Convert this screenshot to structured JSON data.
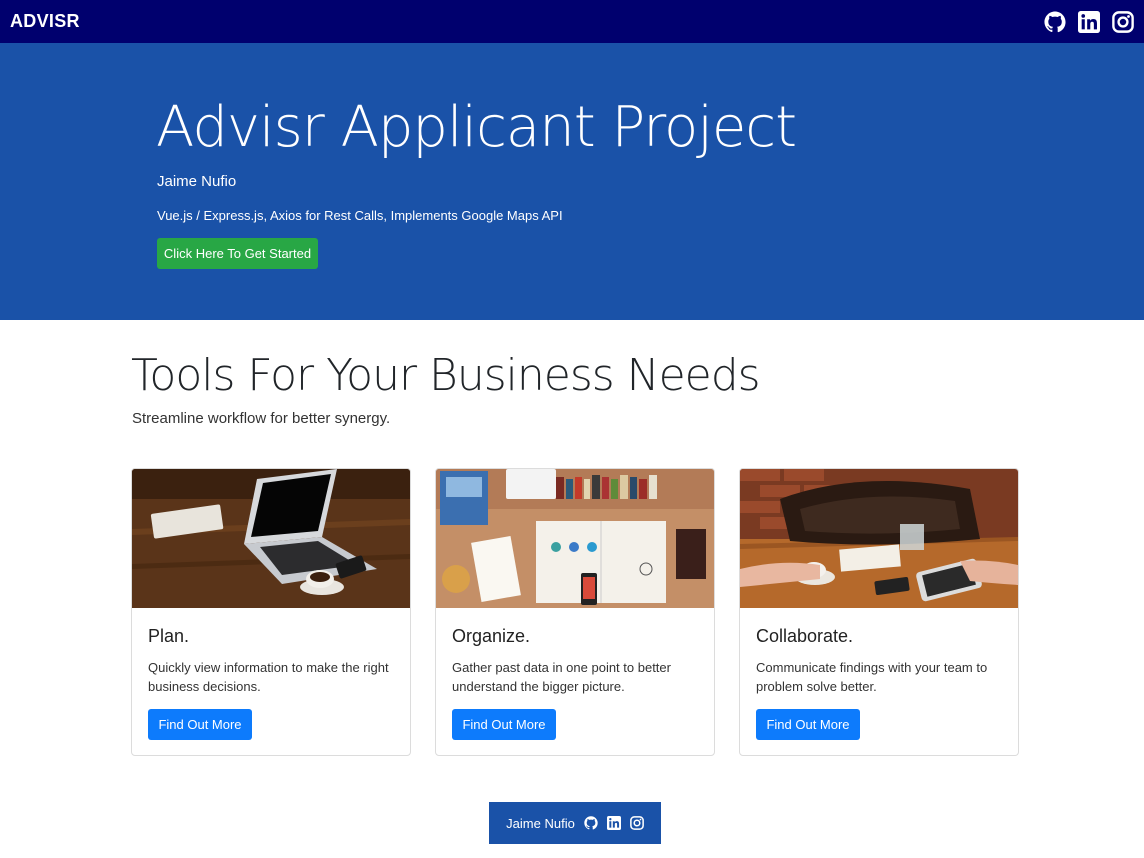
{
  "navbar": {
    "brand": "ADVISR",
    "icons": [
      "github-icon",
      "linkedin-icon",
      "instagram-icon"
    ]
  },
  "hero": {
    "title": "Advisr Applicant Project",
    "author": "Jaime Nufio",
    "tech": "Vue.js / Express.js, Axios for Rest Calls, Implements Google Maps API",
    "button_label": "Click Here To Get Started"
  },
  "section": {
    "title": "Tools For Your Business Needs",
    "subtitle": "Streamline workflow for better synergy."
  },
  "cards": [
    {
      "title": "Plan.",
      "text": "Quickly view information to make the right business decisions.",
      "button_label": "Find Out More"
    },
    {
      "title": "Organize.",
      "text": "Gather past data in one point to better understand the bigger picture.",
      "button_label": "Find Out More"
    },
    {
      "title": "Collaborate.",
      "text": "Communicate findings with your team to problem solve better.",
      "button_label": "Find Out More"
    }
  ],
  "footer": {
    "name": "Jaime Nufio",
    "icons": [
      "github-icon",
      "linkedin-icon",
      "instagram-icon"
    ]
  },
  "colors": {
    "navbar": "#00006e",
    "hero": "#1a52a8",
    "hero_button": "#28a745",
    "card_button": "#0d7bfc"
  }
}
